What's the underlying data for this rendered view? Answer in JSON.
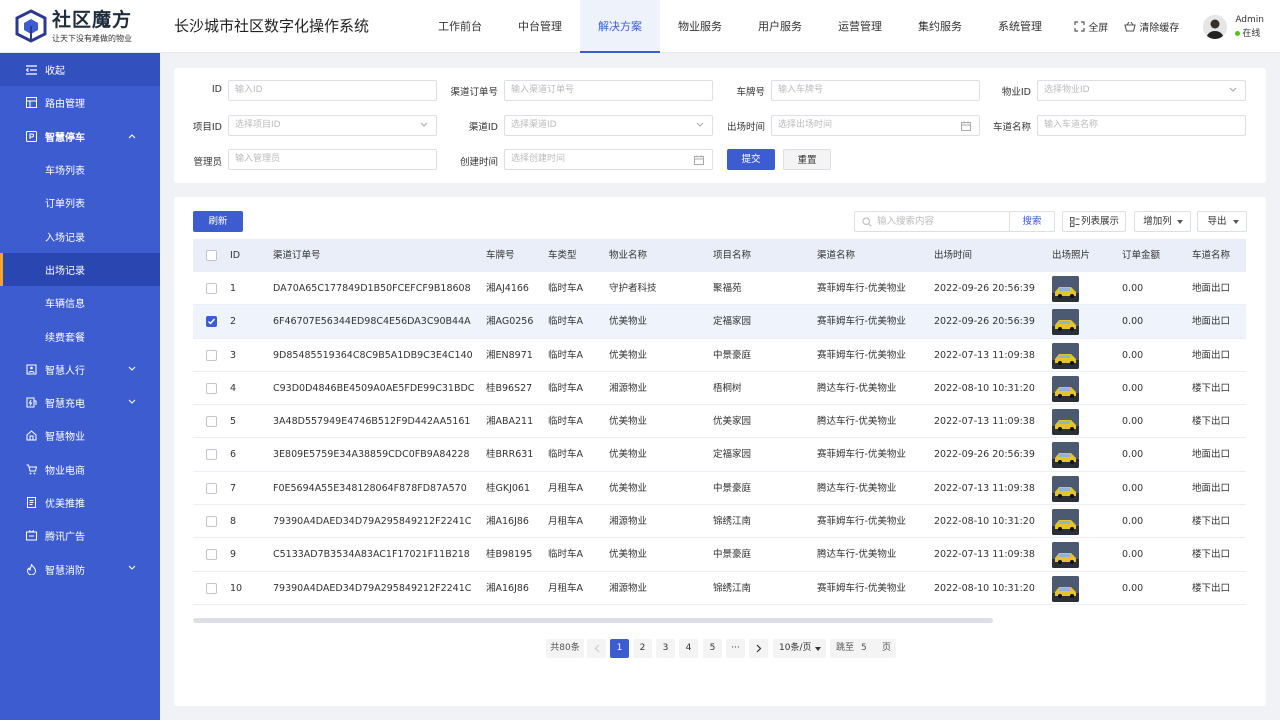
{
  "header": {
    "logo_title": "社区魔方",
    "logo_sub": "让天下没有难做的物业",
    "system_title": "长沙城市社区数字化操作系统",
    "nav": [
      "工作前台",
      "中台管理",
      "解决方案",
      "物业服务",
      "用户服务",
      "运营管理",
      "集约服务",
      "系统管理"
    ],
    "active_nav": "解决方案",
    "fullscreen": "全屏",
    "clear_cache": "清除缓存",
    "user_name": "Admin",
    "user_status": "在线"
  },
  "sidebar": {
    "collapse": "收起",
    "route": "路由管理",
    "parking": "智慧停车",
    "parking_items": [
      "车场列表",
      "订单列表",
      "入场记录",
      "出场记录",
      "车辆信息",
      "续费套餐"
    ],
    "active_item": "出场记录",
    "others": [
      "智慧人行",
      "智慧充电",
      "智慧物业",
      "物业电商",
      "优美推推",
      "腾讯广告",
      "智慧消防"
    ]
  },
  "filter": {
    "id_label": "ID",
    "id_ph": "输入ID",
    "order_label": "渠道订单号",
    "order_ph": "输入渠道订单号",
    "plate_label": "车牌号",
    "plate_ph": "输入车牌号",
    "prop_label": "物业ID",
    "prop_ph": "选择物业ID",
    "proj_label": "项目ID",
    "proj_ph": "选择项目ID",
    "chan_label": "渠道ID",
    "chan_ph": "选择渠道ID",
    "exit_label": "出场时间",
    "exit_ph": "选择出场时间",
    "lane_label": "车道名称",
    "lane_ph": "输入车道名称",
    "admin_label": "管理员",
    "admin_ph": "输入管理员",
    "create_label": "创建时间",
    "create_ph": "选择创建时间",
    "submit": "提交",
    "reset": "重置"
  },
  "toolbar": {
    "refresh": "刷新",
    "search_ph": "输入搜索内容",
    "search": "搜索",
    "list_view": "列表展示",
    "add_col": "增加列",
    "export": "导出"
  },
  "table": {
    "columns": [
      "ID",
      "渠道订单号",
      "车牌号",
      "车类型",
      "物业名称",
      "项目名称",
      "渠道名称",
      "出场时间",
      "出场照片",
      "订单金额",
      "车道名称"
    ],
    "rows": [
      {
        "id": "1",
        "order": "DA70A65C177849D1B50FCEFCF9B18608",
        "plate": "湘AJ4166",
        "type": "临时车A",
        "prop": "守护者科技",
        "proj": "聚福苑",
        "chan": "赛菲姆车行-优美物业",
        "time": "2022-09-26 20:56:39",
        "amount": "0.00",
        "lane": "地面出口",
        "checked": false
      },
      {
        "id": "2",
        "order": "6F46707E56344ED98C4E56DA3C90B44A",
        "plate": "湘AG0256",
        "type": "临时车A",
        "prop": "优美物业",
        "proj": "定福家园",
        "chan": "赛菲姆车行-优美物业",
        "time": "2022-09-26 20:56:39",
        "amount": "0.00",
        "lane": "地面出口",
        "checked": true
      },
      {
        "id": "3",
        "order": "9D85485519364C8C9B5A1DB9C3E4C140",
        "plate": "湘EN8971",
        "type": "临时车A",
        "prop": "优美物业",
        "proj": "中景豪庭",
        "chan": "赛菲姆车行-优美物业",
        "time": "2022-07-13 11:09:38",
        "amount": "0.00",
        "lane": "地面出口",
        "checked": false
      },
      {
        "id": "4",
        "order": "C93D0D4846BE4509A0AE5FDE99C31BDC",
        "plate": "桂B96S27",
        "type": "临时车A",
        "prop": "湘源物业",
        "proj": "梧桐树",
        "chan": "腾达车行-优美物业",
        "time": "2022-08-10 10:31:20",
        "amount": "0.00",
        "lane": "楼下出口",
        "checked": false
      },
      {
        "id": "5",
        "order": "3A48D557949E4746B512F9D442AA5161",
        "plate": "湘ABA211",
        "type": "临时车A",
        "prop": "优美物业",
        "proj": "优美家园",
        "chan": "腾达车行-优美物业",
        "time": "2022-07-13 11:09:38",
        "amount": "0.00",
        "lane": "楼下出口",
        "checked": false
      },
      {
        "id": "6",
        "order": "3E809E5759E34A38859CDC0FB9A84228",
        "plate": "桂BRR631",
        "type": "临时车A",
        "prop": "优美物业",
        "proj": "定福家园",
        "chan": "赛菲姆车行-优美物业",
        "time": "2022-09-26 20:56:39",
        "amount": "0.00",
        "lane": "地面出口",
        "checked": false
      },
      {
        "id": "7",
        "order": "F0E5694A55E348128064F878FD87A570",
        "plate": "桂GKJ061",
        "type": "月租车A",
        "prop": "优美物业",
        "proj": "中景豪庭",
        "chan": "腾达车行-优美物业",
        "time": "2022-07-13 11:09:38",
        "amount": "0.00",
        "lane": "地面出口",
        "checked": false
      },
      {
        "id": "8",
        "order": "79390A4DAED34D79A295849212F2241C",
        "plate": "湘A16J86",
        "type": "月租车A",
        "prop": "湘源物业",
        "proj": "锦绣江南",
        "chan": "赛菲姆车行-优美物业",
        "time": "2022-08-10 10:31:20",
        "amount": "0.00",
        "lane": "楼下出口",
        "checked": false
      },
      {
        "id": "9",
        "order": "C5133AD7B3534A83AC1F17021F11B218",
        "plate": "桂B98195",
        "type": "临时车A",
        "prop": "优美物业",
        "proj": "中景豪庭",
        "chan": "腾达车行-优美物业",
        "time": "2022-07-13 11:09:38",
        "amount": "0.00",
        "lane": "楼下出口",
        "checked": false
      },
      {
        "id": "10",
        "order": "79390A4DAED34D79A295849212F2241C",
        "plate": "湘A16J86",
        "type": "月租车A",
        "prop": "湘源物业",
        "proj": "锦绣江南",
        "chan": "赛菲姆车行-优美物业",
        "time": "2022-08-10 10:31:20",
        "amount": "0.00",
        "lane": "楼下出口",
        "checked": false
      }
    ]
  },
  "pagination": {
    "total": "共80条",
    "pages": [
      "1",
      "2",
      "3",
      "4",
      "5"
    ],
    "current": "1",
    "ellipsis": "···",
    "page_size": "10条/页",
    "goto_label": "跳至",
    "goto_value": "5",
    "goto_suffix": "页"
  },
  "colors": {
    "primary": "#3d5ccf",
    "sidebar": "#3d5ccf",
    "active_marker": "#f5a623"
  }
}
